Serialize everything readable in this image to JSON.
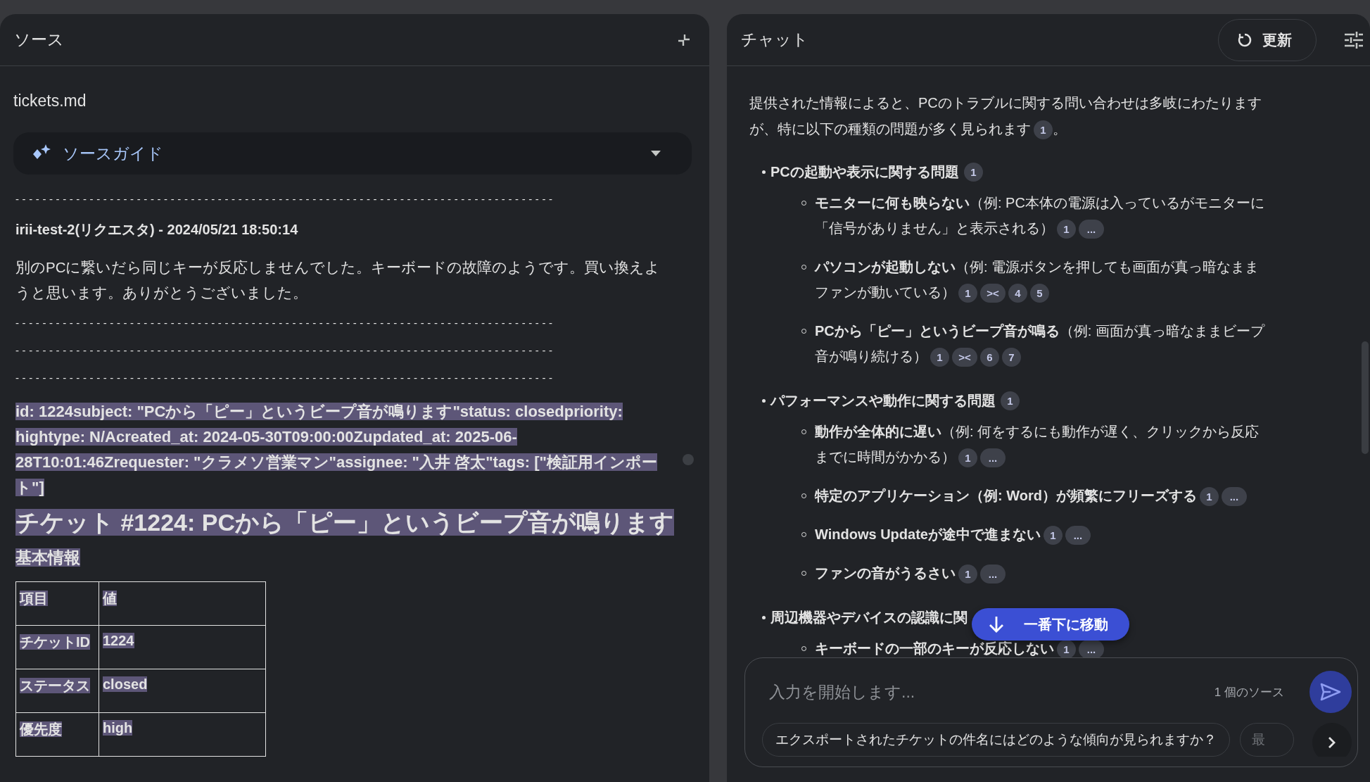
{
  "sources_panel": {
    "title": "ソース",
    "file_title": "tickets.md",
    "source_guide": {
      "label": "ソースガイド",
      "expanded": false
    },
    "blocks": [
      {
        "kind": "rule",
        "text": "--------------------------------------------------------------------------------",
        "highlighted": false
      },
      {
        "kind": "author",
        "text": "irii-test-2(リクエスタ) - 2024/05/21 18:50:14",
        "highlighted": false
      },
      {
        "kind": "paragraph",
        "text": "別のPCに繋いだら同じキーが反応しませんでした。キーボードの故障のようです。買い換えようと思います。ありがとうございました。",
        "highlighted": false
      },
      {
        "kind": "rule",
        "text": "--------------------------------------------------------------------------------",
        "highlighted": false
      },
      {
        "kind": "rule",
        "text": "--------------------------------------------------------------------------------",
        "highlighted": false
      },
      {
        "kind": "rule",
        "text": "--------------------------------------------------------------------------------",
        "highlighted": false
      },
      {
        "kind": "meta",
        "text": "id: 1224subject: \"PCから「ピー」というビープ音が鳴ります\"status: closedpriority: hightype: N/Acreated_at: 2024-05-30T09:00:00Zupdated_at: 2025-06-28T10:01:46Zrequester: \"クラメソ営業マン\"assignee: \"入井 啓太\"tags: [\"検証用インポート\"]",
        "highlighted": true
      },
      {
        "kind": "h1",
        "text": "チケット #1224: PCから「ピー」というビープ音が鳴ります",
        "highlighted": true
      },
      {
        "kind": "h2",
        "text": "基本情報",
        "highlighted": true
      },
      {
        "kind": "table",
        "highlighted": true,
        "rows": [
          [
            "項目",
            "値"
          ],
          [
            "チケットID",
            "1224"
          ],
          [
            "ステータス",
            "closed"
          ],
          [
            "優先度",
            "high"
          ]
        ]
      }
    ]
  },
  "chat_panel": {
    "title": "チャット",
    "refresh_button": "更新",
    "intro": {
      "text": "提供された情報によると、PCのトラブルに関する問い合わせは多岐にわたりますが、特に以下の種類の問題が多く見られます",
      "citations": [
        "1"
      ],
      "after": "。"
    },
    "groups": [
      {
        "title": "PCの起動や表示に関する問題",
        "citations": [
          "1"
        ],
        "items": [
          {
            "text": "**モニターに何も映らない**（例: PC本体の電源は入っているがモニターに「信号がありません」と表示される）",
            "citations": [
              "1",
              "..."
            ]
          },
          {
            "text": "**パソコンが起動しない**（例: 電源ボタンを押しても画面が真っ暗なままファンが動いている）",
            "citations": [
              "1",
              "><",
              "4",
              "5"
            ]
          },
          {
            "text": "**PCから「ピー」というビープ音が鳴る**（例: 画面が真っ暗なままビープ音が鳴り続ける）",
            "citations": [
              "1",
              "><",
              "6",
              "7"
            ]
          }
        ]
      },
      {
        "title": "パフォーマンスや動作に関する問題",
        "citations": [
          "1"
        ],
        "items": [
          {
            "text": "**動作が全体的に遅い**（例: 何をするにも動作が遅く、クリックから反応までに時間がかかる）",
            "citations": [
              "1",
              "..."
            ]
          },
          {
            "text": "**特定のアプリケーション（例: Word）が頻繁にフリーズする**",
            "citations": [
              "1",
              "..."
            ]
          },
          {
            "text": "**Windows Updateが途中で進まない**",
            "citations": [
              "1",
              "..."
            ]
          },
          {
            "text": "**ファンの音がうるさい**",
            "citations": [
              "1",
              "..."
            ]
          }
        ]
      },
      {
        "title": "周辺機器やデバイスの認識に関",
        "items": [
          {
            "text": "**キーボードの一部のキーが反応しない**",
            "citations": [
              "1",
              "..."
            ]
          }
        ]
      }
    ],
    "scroll_button": "一番下に移動",
    "input": {
      "placeholder": "入力を開始します...",
      "source_count": "1 個のソース"
    },
    "suggestions": [
      "エクスポートされたチケットの件名にはどのような傾向が見られますか？",
      "最"
    ]
  }
}
